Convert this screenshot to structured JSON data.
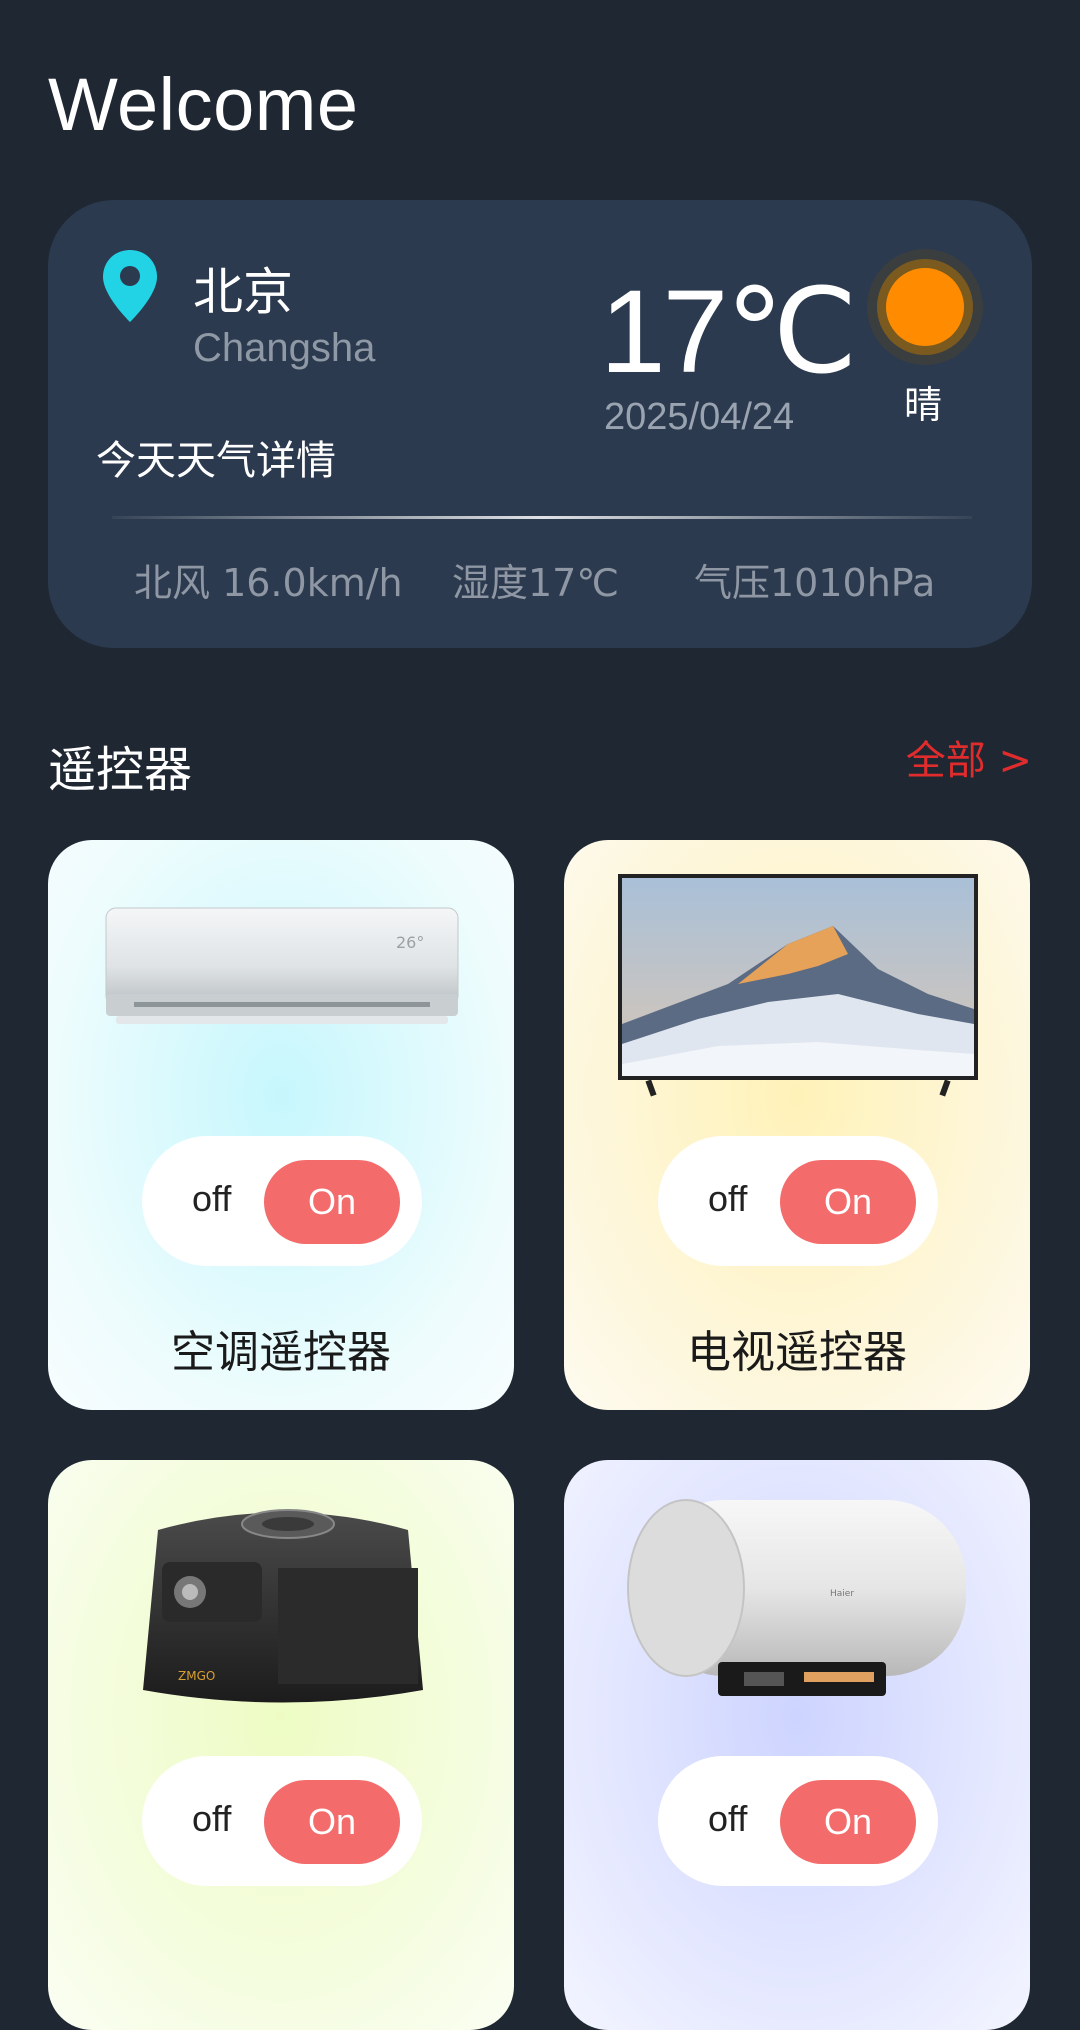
{
  "header": {
    "title": "Welcome"
  },
  "weather": {
    "city": "北京",
    "city_en": "Changsha",
    "detail_label": "今天天气详情",
    "temperature": "17℃",
    "date": "2025/04/24",
    "condition": "晴",
    "wind": "北风 16.0km/h",
    "humidity": "湿度17℃",
    "pressure": "气压1010hPa",
    "icon": "sun-icon",
    "accent": "#ff8c00"
  },
  "remotes": {
    "section_title": "遥控器",
    "all_label": "全部 >",
    "items": [
      {
        "name": "空调遥控器",
        "off": "off",
        "on": "On",
        "icon": "air-conditioner-image"
      },
      {
        "name": "电视遥控器",
        "off": "off",
        "on": "On",
        "icon": "tv-image"
      },
      {
        "name": "",
        "off": "off",
        "on": "On",
        "icon": "projector-image"
      },
      {
        "name": "",
        "off": "off",
        "on": "On",
        "icon": "water-heater-image"
      }
    ]
  },
  "colors": {
    "on_button": "#f36b6b",
    "all_link": "#e02c2c",
    "pin": "#22d3e6"
  }
}
